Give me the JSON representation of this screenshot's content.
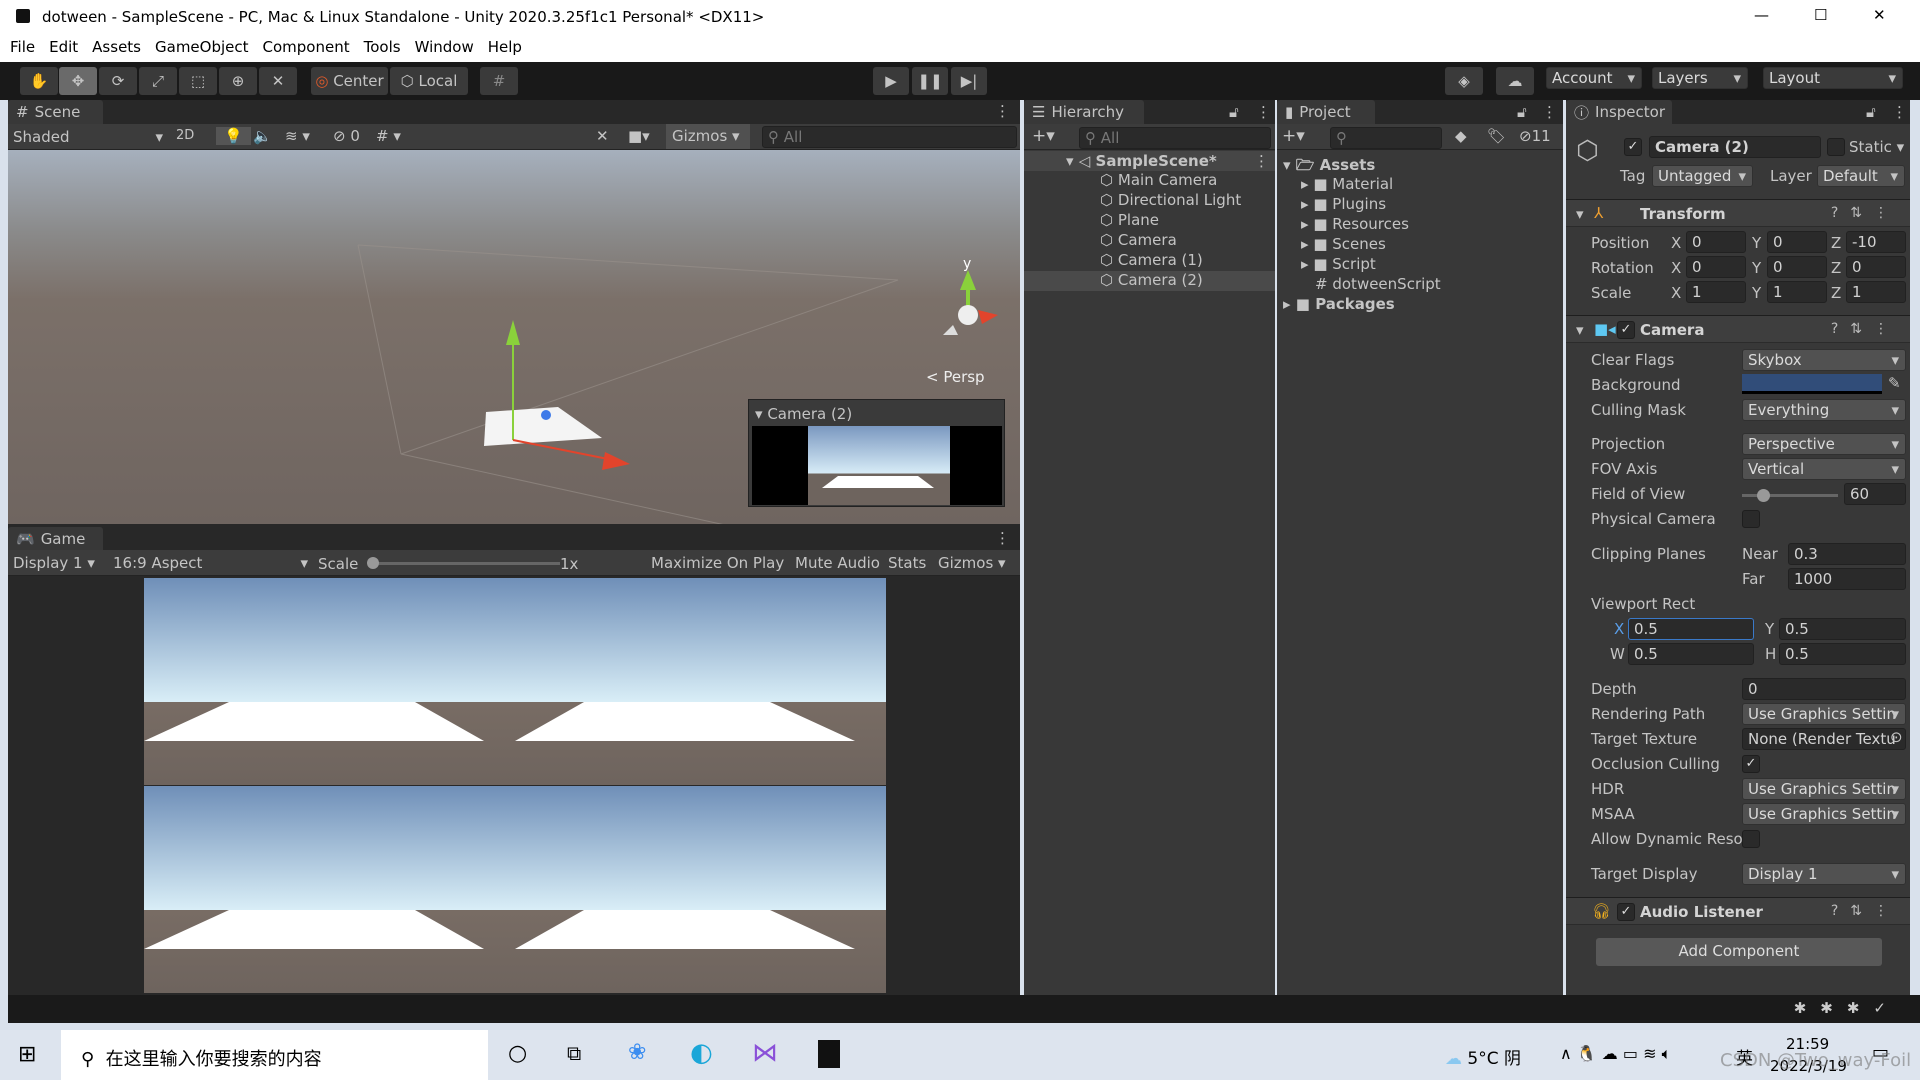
{
  "window": {
    "title": "dotween - SampleScene - PC, Mac & Linux Standalone - Unity 2020.3.25f1c1 Personal* <DX11>",
    "controls": [
      "—",
      "☐",
      "✕"
    ]
  },
  "menu": [
    "File",
    "Edit",
    "Assets",
    "GameObject",
    "Component",
    "Tools",
    "Window",
    "Help"
  ],
  "toolbar": {
    "tools": [
      "hand-tool",
      "move-tool",
      "rotate-tool",
      "scale-tool",
      "rect-tool",
      "transform-tool",
      "custom-tool"
    ],
    "pivot": "Center",
    "space": "Local",
    "account": "Account",
    "layers": "Layers",
    "layout": "Layout"
  },
  "scene": {
    "tab": "Scene",
    "shading": "Shaded",
    "mode2d": "2D",
    "hidden_count": "0",
    "gizmos": "Gizmos",
    "search_placeholder": "All",
    "persp": "< Persp",
    "axis_y": "y",
    "preview_title": "Camera (2)"
  },
  "game": {
    "tab": "Game",
    "display": "Display 1",
    "aspect": "16:9 Aspect",
    "scale_label": "Scale",
    "scale_value": "1x",
    "buttons": [
      "Maximize On Play",
      "Mute Audio",
      "Stats",
      "Gizmos"
    ]
  },
  "hierarchy": {
    "tab": "Hierarchy",
    "search_placeholder": "All",
    "scene": "SampleScene*",
    "items": [
      "Main Camera",
      "Directional Light",
      "Plane",
      "Camera",
      "Camera (1)",
      "Camera (2)"
    ],
    "selected": "Camera (2)"
  },
  "project": {
    "tab": "Project",
    "hidden_count": "11",
    "root": "Assets",
    "folders": [
      "Material",
      "Plugins",
      "Resources",
      "Scenes",
      "Script"
    ],
    "script": "dotweenScript",
    "packages": "Packages"
  },
  "inspector": {
    "tab": "Inspector",
    "name": "Camera (2)",
    "active": true,
    "static_label": "Static",
    "tag_label": "Tag",
    "tag": "Untagged",
    "layer_label": "Layer",
    "layer": "Default",
    "transform": {
      "title": "Transform",
      "position_label": "Position",
      "rotation_label": "Rotation",
      "scale_label": "Scale",
      "position": [
        "0",
        "0",
        "-10"
      ],
      "rotation": [
        "0",
        "0",
        "0"
      ],
      "scale": [
        "1",
        "1",
        "1"
      ],
      "axes": [
        "X",
        "Y",
        "Z"
      ]
    },
    "camera": {
      "title": "Camera",
      "clear_flags_label": "Clear Flags",
      "clear_flags": "Skybox",
      "background_label": "Background",
      "background_color": "#314D79",
      "culling_mask_label": "Culling Mask",
      "culling_mask": "Everything",
      "projection_label": "Projection",
      "projection": "Perspective",
      "fov_axis_label": "FOV Axis",
      "fov_axis": "Vertical",
      "fov_label": "Field of View",
      "fov": "60",
      "fov_fraction": 0.22,
      "physical_label": "Physical Camera",
      "physical": false,
      "clipping_label": "Clipping Planes",
      "near_label": "Near",
      "near": "0.3",
      "far_label": "Far",
      "far": "1000",
      "viewport_label": "Viewport Rect",
      "vx_label": "X",
      "vx": "0.5",
      "vy_label": "Y",
      "vy": "0.5",
      "vw_label": "W",
      "vw": "0.5",
      "vh_label": "H",
      "vh": "0.5",
      "depth_label": "Depth",
      "depth": "0",
      "rendering_label": "Rendering Path",
      "rendering": "Use Graphics Settin",
      "target_texture_label": "Target Texture",
      "target_texture": "None (Render Textu",
      "occlusion_label": "Occlusion Culling",
      "occlusion": true,
      "hdr_label": "HDR",
      "hdr": "Use Graphics Settin",
      "msaa_label": "MSAA",
      "msaa": "Use Graphics Settin",
      "dynres_label": "Allow Dynamic Reso",
      "dynres": false,
      "target_display_label": "Target Display",
      "target_display": "Display 1"
    },
    "audio": {
      "title": "Audio Listener"
    },
    "add_component": "Add Component"
  },
  "taskbar": {
    "search_placeholder": "在这里输入你要搜索的内容",
    "weather": "5°C 阴",
    "ime": "英",
    "time": "21:59",
    "date": "2022/3/19",
    "watermark": "CSDN @Two_way-Foil"
  }
}
